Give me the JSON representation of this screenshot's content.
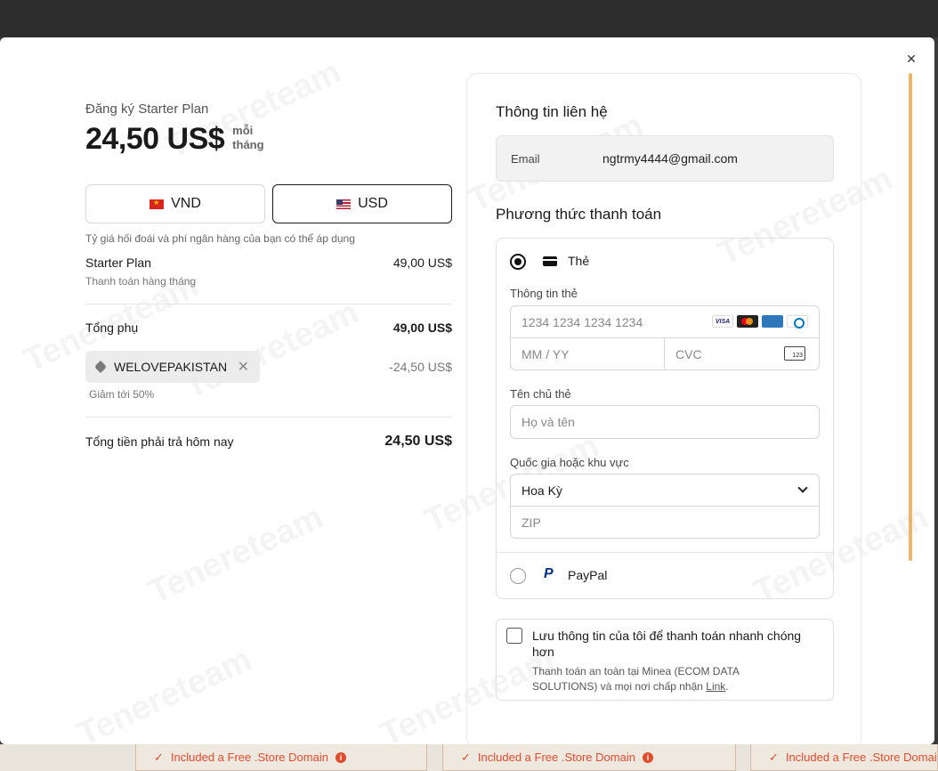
{
  "bottom_cards": [
    {
      "text": "Included a Free .Store Domain"
    },
    {
      "text": "Included a Free .Store Domain"
    },
    {
      "text": "Included a Free .Store Domain"
    }
  ],
  "modal": {
    "close_icon": "close-icon"
  },
  "order": {
    "plan_title": "Đăng ký Starter Plan",
    "price": "24,50 US$",
    "per": "mỗi tháng",
    "currencies": [
      {
        "code": "VND",
        "flag": "vietnam-flag-icon",
        "active": false
      },
      {
        "code": "USD",
        "flag": "us-flag-icon",
        "active": true
      }
    ],
    "fx_note": "Tỷ giá hối đoái và phí ngân hàng của bạn có thể áp dụng",
    "item_name": "Starter Plan",
    "item_billing": "Thanh toán hàng tháng",
    "item_amount": "49,00 US$",
    "subtotal_label": "Tổng phụ",
    "subtotal_amount": "49,00 US$",
    "coupon_code": "WELOVEPAKISTAN",
    "coupon_discount": "-24,50 US$",
    "coupon_note": "Giảm tới 50%",
    "total_label": "Tổng tiền phải trả hôm nay",
    "total_amount": "24,50 US$"
  },
  "contact": {
    "title": "Thông tin liên hệ",
    "email_label": "Email",
    "email_value": "ngtrmy4444@gmail.com"
  },
  "payment": {
    "title": "Phương thức thanh toán",
    "card_option_label": "Thẻ",
    "card_info_label": "Thông tin thẻ",
    "card_number_placeholder": "1234 1234 1234 1234",
    "card_brands": [
      "VISA",
      "Mastercard",
      "AMEX",
      "Diners"
    ],
    "expiry_placeholder": "MM / YY",
    "cvc_placeholder": "CVC",
    "cvc_icon_text": "123",
    "cardholder_label": "Tên chủ thẻ",
    "cardholder_placeholder": "Họ và tên",
    "country_label": "Quốc gia hoặc khu vực",
    "country_value": "Hoa Kỳ",
    "zip_placeholder": "ZIP",
    "paypal_label": "PayPal",
    "paypal_icon_text": "P"
  },
  "save_info": {
    "title": "Lưu thông tin của tôi để thanh toán nhanh chóng hơn",
    "subtitle": "Thanh toán an toàn tại Minea (ECOM DATA SOLUTIONS) và mọi nơi chấp nhận ",
    "link": "Link",
    "suffix": "."
  },
  "watermark": "Tenereteam",
  "colors": {
    "accent_scrollbar": "#f3b46a",
    "bottom_text": "#e04b2e"
  }
}
